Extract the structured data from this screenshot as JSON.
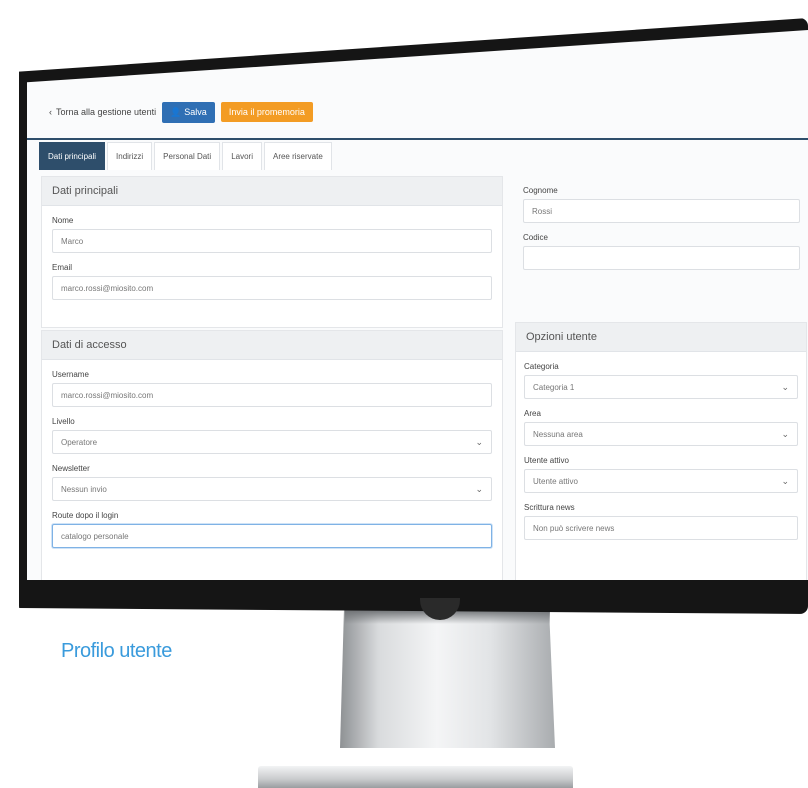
{
  "toolbar": {
    "back_label": "Torna alla gestione utenti",
    "save_label": "Salva",
    "secondary_label": "Invia il promemoria"
  },
  "tabs": [
    "Dati principali",
    "Indirizzi",
    "Personal Dati",
    "Lavori",
    "Aree riservate"
  ],
  "dati_principali": {
    "header": "Dati principali",
    "nome_label": "Nome",
    "nome_value": "Marco",
    "email_label": "Email",
    "email_value": "marco.rossi@miosito.com",
    "cognome_label": "Cognome",
    "cognome_value": "Rossi",
    "cod_label": "Codice",
    "cod_value": ""
  },
  "accesso": {
    "header": "Dati di accesso",
    "username_label": "Username",
    "username_value": "marco.rossi@miosito.com",
    "livello_label": "Livello",
    "livello_value": "Operatore",
    "newsletter_label": "Newsletter",
    "newsletter_value": "Nessun invio",
    "route_label": "Route dopo il login",
    "route_value": "catalogo personale"
  },
  "opzioni": {
    "header": "Opzioni utente",
    "categoria_label": "Categoria",
    "categoria_value": "Categoria 1",
    "area_label": "Area",
    "area_value": "Nessuna area",
    "attivo_label": "Utente attivo",
    "attivo_value": "Utente attivo",
    "scrittura_label": "Scrittura news",
    "scrittura_value": "Non può scrivere news"
  },
  "caption": "Profilo utente",
  "colors": {
    "accent": "#2e4e6b",
    "save": "#2f6fb4",
    "orange": "#f39c24",
    "caption": "#3a9bdc"
  }
}
